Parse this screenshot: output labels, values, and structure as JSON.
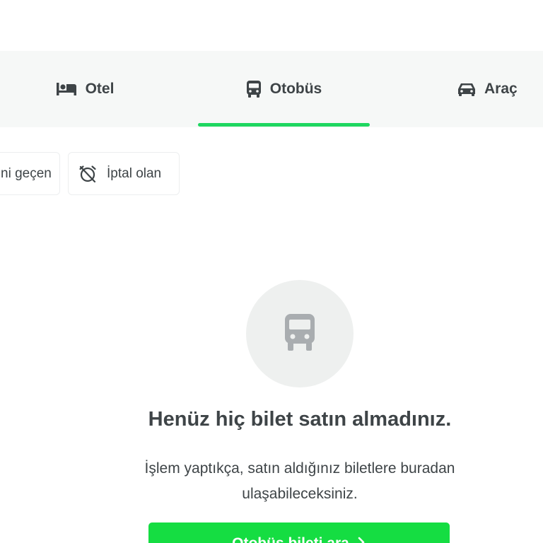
{
  "tabs": [
    {
      "label": "Otel",
      "icon": "bed-icon",
      "active": false
    },
    {
      "label": "Otobüs",
      "icon": "bus-icon",
      "active": true
    },
    {
      "label": "Araç",
      "icon": "car-icon",
      "active": false
    }
  ],
  "filters": [
    {
      "label": "ni geçen",
      "icon": ""
    },
    {
      "label": "İptal olan",
      "icon": "alarm-off-icon"
    }
  ],
  "empty_state": {
    "icon": "bus-icon",
    "title": "Henüz hiç bilet satın almadınız.",
    "description": "İşlem yaptıkça, satın aldığınız biletlere buradan ulaşabileceksiniz.",
    "button_label": "Otobüs bileti ara",
    "button_icon": "chevron-right-icon"
  },
  "colors": {
    "accent": "#1ed760",
    "button": "#15dd42",
    "text": "#3e4447",
    "tab_background": "#f6f8f7",
    "empty_icon_background": "#eef0ef",
    "empty_icon": "#a9adb0"
  }
}
